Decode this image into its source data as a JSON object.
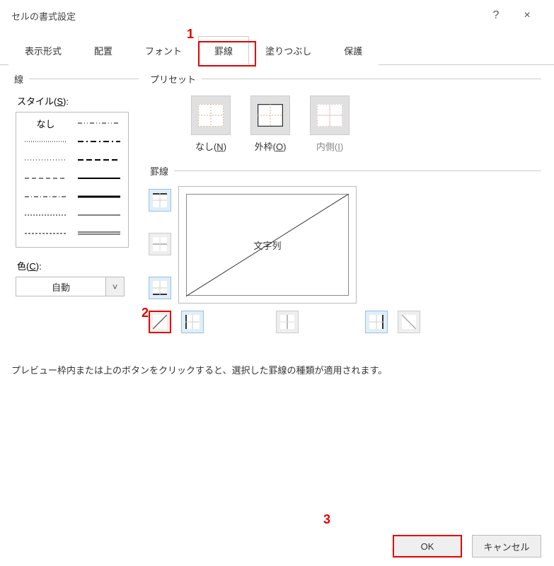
{
  "title": "セルの書式設定",
  "titlebar": {
    "help": "?",
    "close": "×"
  },
  "tabs": [
    {
      "label": "表示形式"
    },
    {
      "label": "配置"
    },
    {
      "label": "フォント"
    },
    {
      "label": "罫線",
      "active": true
    },
    {
      "label": "塗りつぶし"
    },
    {
      "label": "保護"
    }
  ],
  "line_group": {
    "legend": "線",
    "style_label": "スタイル(S):"
  },
  "styles": {
    "none_label": "なし"
  },
  "color": {
    "label": "色(C):",
    "value": "自動"
  },
  "preset": {
    "legend": "プリセット",
    "none": "なし(N)",
    "outer": "外枠(O)",
    "inner": "内側(I)"
  },
  "border_group": {
    "legend": "罫線",
    "preview_text": "文字列"
  },
  "hint": "プレビュー枠内または上のボタンをクリックすると、選択した罫線の種類が適用されます。",
  "buttons": {
    "ok": "OK",
    "cancel": "キャンセル"
  },
  "annotations": {
    "one": "1",
    "two": "2",
    "three": "3"
  }
}
